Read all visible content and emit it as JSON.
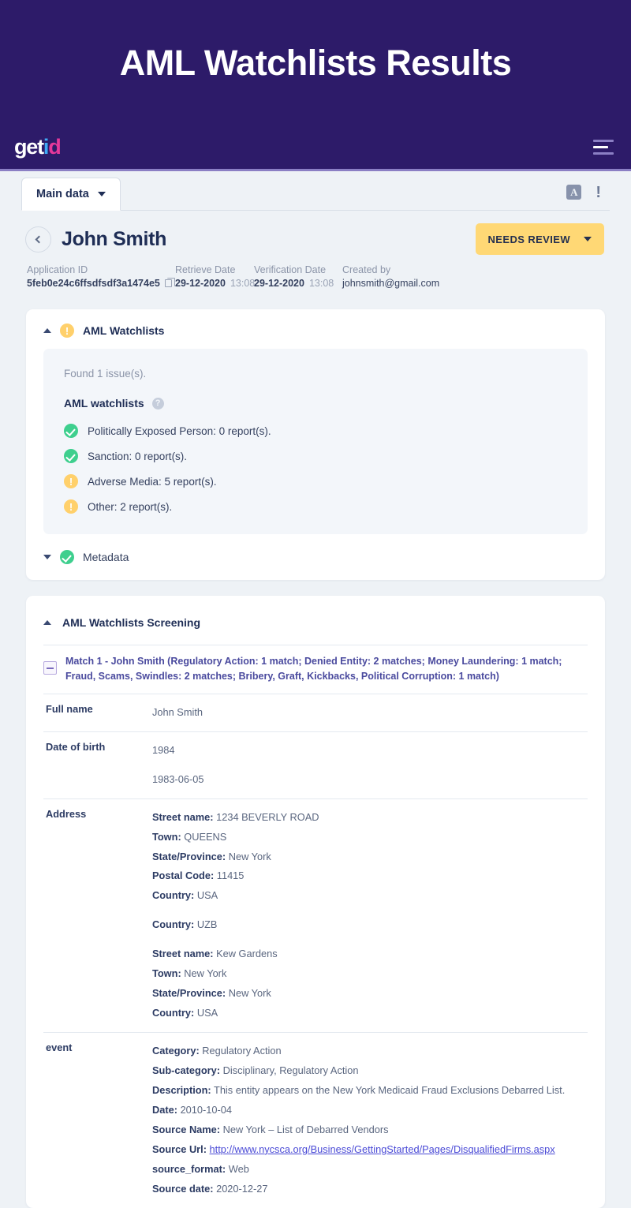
{
  "hero": {
    "title": "AML Watchlists Results",
    "logo": {
      "part1": "get",
      "part2": "i",
      "part3": "d"
    },
    "menu_icon": "hamburger-icon",
    "bg_color": "#2d1b69"
  },
  "tabs": {
    "items": [
      {
        "label": "Main data"
      }
    ],
    "actions": {
      "pdf_label": "A",
      "more_label": "!"
    }
  },
  "header": {
    "back_label": "",
    "title": "John Smith",
    "status": {
      "label": "NEEDS REVIEW",
      "color": "#ffd875"
    }
  },
  "meta": {
    "application_id": {
      "label": "Application ID",
      "value": "5feb0e24c6ffsdfsdf3a1474e5"
    },
    "retrieve_date": {
      "label": "Retrieve Date",
      "date": "29-12-2020",
      "time": "13:08"
    },
    "verification_date": {
      "label": "Verification Date",
      "date": "29-12-2020",
      "time": "13:08"
    },
    "created_by": {
      "label": "Created by",
      "value": "johnsmith@gmail.com"
    }
  },
  "aml_card": {
    "section_title": "AML Watchlists",
    "section_status": "warning",
    "found_text": "Found 1 issue(s).",
    "panel_subtitle": "AML watchlists",
    "help_glyph": "?",
    "items": [
      {
        "status": "ok",
        "text": "Politically Exposed Person: 0 report(s)."
      },
      {
        "status": "ok",
        "text": "Sanction: 0 report(s)."
      },
      {
        "status": "warn",
        "text": "Adverse Media: 5 report(s)."
      },
      {
        "status": "warn",
        "text": "Other: 2 report(s)."
      }
    ],
    "metadata_label": "Metadata",
    "metadata_status": "ok"
  },
  "screening": {
    "title": "AML Watchlists Screening",
    "match_title": "Match 1 - John Smith (Regulatory Action: 1 match; Denied Entity: 2 matches; Money Laundering: 1 match; Fraud, Scams, Swindles: 2 matches; Bribery, Graft, Kickbacks, Political Corruption: 1 match)",
    "rows": [
      {
        "key": "Full name",
        "groups": [
          {
            "lines": [
              {
                "value": "John Smith"
              }
            ]
          }
        ]
      },
      {
        "key": "Date of birth",
        "groups": [
          {
            "lines": [
              {
                "value": "1984"
              }
            ]
          },
          {
            "lines": [
              {
                "value": "1983-06-05"
              }
            ]
          }
        ]
      },
      {
        "key": "Address",
        "groups": [
          {
            "lines": [
              {
                "label": "Street name:",
                "value": "1234 BEVERLY ROAD"
              },
              {
                "label": "Town:",
                "value": "QUEENS"
              },
              {
                "label": "State/Province:",
                "value": "New York"
              },
              {
                "label": "Postal Code:",
                "value": "11415"
              },
              {
                "label": "Country:",
                "value": "USA"
              }
            ]
          },
          {
            "lines": [
              {
                "label": "Country:",
                "value": "UZB"
              }
            ]
          },
          {
            "lines": [
              {
                "label": "Street name:",
                "value": "Kew Gardens"
              },
              {
                "label": "Town:",
                "value": "New York"
              },
              {
                "label": "State/Province:",
                "value": "New York"
              },
              {
                "label": "Country:",
                "value": "USA"
              }
            ]
          }
        ]
      },
      {
        "key": "event",
        "groups": [
          {
            "lines": [
              {
                "label": "Category:",
                "value": "Regulatory Action"
              },
              {
                "label": "Sub-category:",
                "value": "Disciplinary, Regulatory Action"
              },
              {
                "label": "Description:",
                "value": "This entity appears on the New York Medicaid Fraud Exclusions Debarred List."
              },
              {
                "label": "Date:",
                "value": "2010-10-04"
              },
              {
                "label": "Source Name:",
                "value": "New York – List of Debarred Vendors"
              },
              {
                "label": "Source Url:",
                "value": "http://www.nycsca.org/Business/GettingStarted/Pages/DisqualifiedFirms.aspx",
                "link": true
              },
              {
                "label": "source_format:",
                "value": "Web"
              },
              {
                "label": "Source date:",
                "value": "2020-12-27"
              }
            ]
          }
        ]
      }
    ]
  }
}
